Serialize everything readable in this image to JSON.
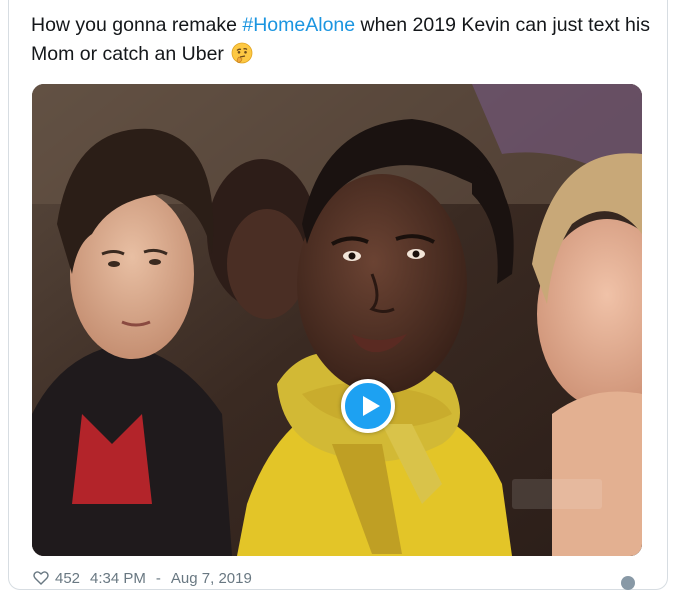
{
  "tweet": {
    "text_before": "How you gonna remake ",
    "hashtag": "#HomeAlone",
    "text_after": " when 2019 Kevin can just text his Mom or catch an Uber",
    "emoji": "thinking-face-emoji"
  },
  "media": {
    "type": "video",
    "play_icon": "play-icon",
    "accent_color": "#1da1f2"
  },
  "footer": {
    "likes": "452",
    "time": "4:34 PM",
    "separator": "-",
    "date": "Aug 7, 2019",
    "info_icon": "info-icon"
  }
}
